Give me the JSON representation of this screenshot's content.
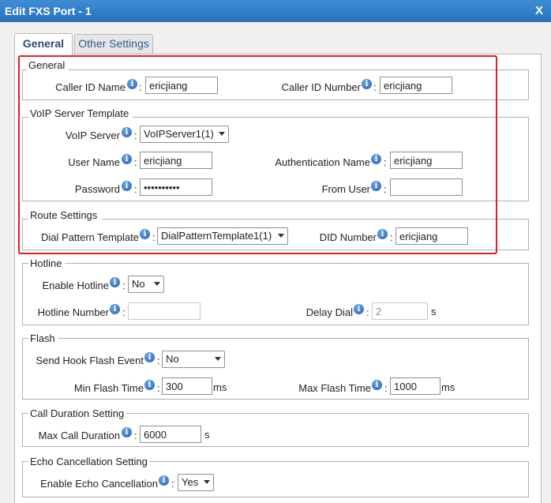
{
  "window": {
    "title": "Edit FXS Port - 1",
    "close_label": "X"
  },
  "tabs": [
    {
      "label": "General"
    },
    {
      "label": "Other Settings"
    }
  ],
  "general": {
    "title": "General",
    "caller_id_name": {
      "label": "Caller ID Name",
      "value": "ericjiang"
    },
    "caller_id_number": {
      "label": "Caller ID Number",
      "value": "ericjiang"
    }
  },
  "voip": {
    "title": "VoIP Server Template",
    "voip_server": {
      "label": "VoIP Server",
      "value": "VoIPServer1(1)"
    },
    "user_name": {
      "label": "User Name",
      "value": "ericjiang"
    },
    "auth_name": {
      "label": "Authentication Name",
      "value": "ericjiang"
    },
    "password": {
      "label": "Password",
      "value": "ericjiang1"
    },
    "from_user": {
      "label": "From User",
      "value": ""
    }
  },
  "route": {
    "title": "Route Settings",
    "dial_pattern": {
      "label": "Dial Pattern Template",
      "value": "DialPatternTemplate1(1)"
    },
    "did_number": {
      "label": "DID Number",
      "value": "ericjiang"
    }
  },
  "hotline": {
    "title": "Hotline",
    "enable": {
      "label": "Enable Hotline",
      "value": "No"
    },
    "number": {
      "label": "Hotline Number",
      "value": ""
    },
    "delay": {
      "label": "Delay Dial",
      "value": "2",
      "unit": "s"
    }
  },
  "flash": {
    "title": "Flash",
    "hook_event": {
      "label": "Send Hook Flash Event",
      "value": "No"
    },
    "min_time": {
      "label": "Min Flash Time",
      "value": "300",
      "unit": "ms"
    },
    "max_time": {
      "label": "Max Flash Time",
      "value": "1000",
      "unit": "ms"
    }
  },
  "call_duration": {
    "title": "Call Duration Setting",
    "max": {
      "label": "Max Call Duration",
      "value": "6000",
      "unit": "s"
    }
  },
  "echo": {
    "title": "Echo Cancellation Setting",
    "enable": {
      "label": "Enable Echo Cancellation",
      "value": "Yes"
    }
  },
  "colors": {
    "title_bar": "#2f7cc6",
    "highlight_box": "#e02020",
    "info_icon": "#1f5fb5"
  }
}
